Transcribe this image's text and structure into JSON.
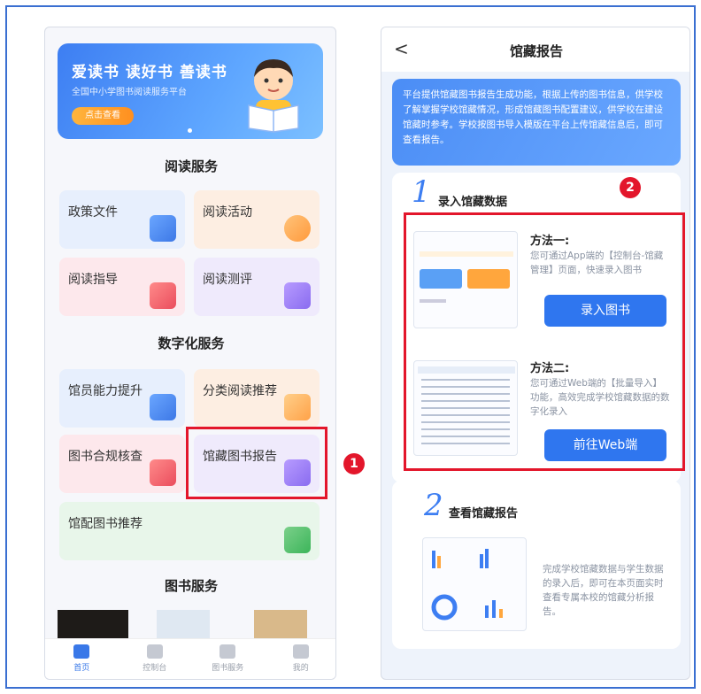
{
  "left": {
    "banner": {
      "title": "爱读书 读好书 善读书",
      "subtitle": "全国中小学图书阅读服务平台",
      "button": "点击查看"
    },
    "sections": {
      "reading": "阅读服务",
      "digital": "数字化服务",
      "books": "图书服务"
    },
    "cards": {
      "policy": "政策文件",
      "activity": "阅读活动",
      "guide": "阅读指导",
      "evaluation": "阅读测评",
      "staff": "馆员能力提升",
      "category": "分类阅读推荐",
      "compliance": "图书合规核查",
      "report": "馆藏图书报告",
      "recommend": "馆配图书推荐"
    },
    "tabs": [
      "首页",
      "控制台",
      "图书服务",
      "我的"
    ]
  },
  "annotations": {
    "badge1": "1",
    "badge2": "2"
  },
  "right": {
    "title": "馆藏报告",
    "back": "<",
    "intro": "平台提供馆藏图书报告生成功能，根据上传的图书信息，供学校了解掌握学校馆藏情况，形成馆藏图书配置建议，供学校在建设馆藏时参考。学校按图书导入模版在平台上传馆藏信息后，即可查看报告。",
    "step1": {
      "num": "1",
      "title": "录入馆藏数据",
      "method1_title": "方法一:",
      "method1_desc": "您可通过App端的【控制台-馆藏管理】页面，快速录入图书",
      "method1_button": "录入图书",
      "method2_title": "方法二:",
      "method2_desc": "您可通过Web端的【批量导入】功能，高效完成学校馆藏数据的数字化录入",
      "method2_button": "前往Web端"
    },
    "step2": {
      "num": "2",
      "title": "查看馆藏报告",
      "desc": "完成学校馆藏数据与学生数据的录入后，即可在本页面实时查看专属本校的馆藏分析报告。"
    }
  }
}
